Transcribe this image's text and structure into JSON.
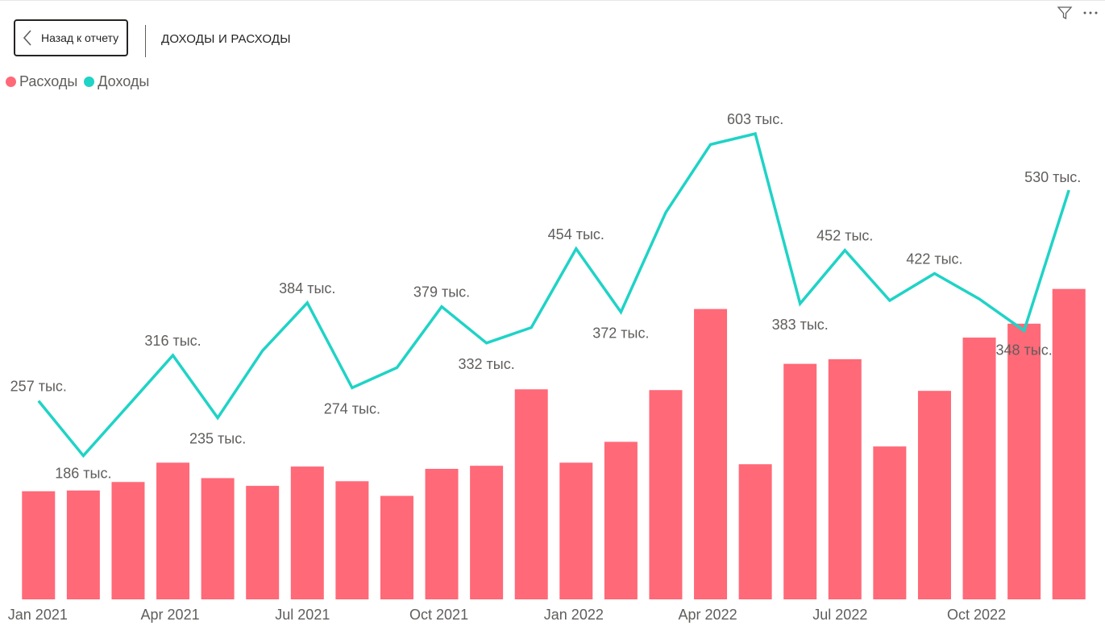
{
  "header": {
    "back_label": "Назад к отчету",
    "title": "ДОХОДЫ И РАСХОДЫ"
  },
  "icons": {
    "back": "chevron-left-icon",
    "filter": "filter-icon",
    "more": "more-options-icon"
  },
  "colors": {
    "expenses": "#FF6978",
    "income": "#1FD3C6",
    "text": "#605e5c"
  },
  "chart_data": {
    "type": "bar",
    "combo": "bar+line",
    "months": [
      "Jan 2021",
      "Feb 2021",
      "Mar 2021",
      "Apr 2021",
      "May 2021",
      "Jun 2021",
      "Jul 2021",
      "Aug 2021",
      "Sep 2021",
      "Oct 2021",
      "Nov 2021",
      "Dec 2021",
      "Jan 2022",
      "Feb 2022",
      "Mar 2022",
      "Apr 2022",
      "May 2022",
      "Jun 2022",
      "Jul 2022",
      "Aug 2022",
      "Sep 2022",
      "Oct 2022",
      "Nov 2022",
      "Dec 2022"
    ],
    "x_tick_labels": [
      {
        "index": 0,
        "label": "Jan 2021"
      },
      {
        "index": 3,
        "label": "Apr 2021"
      },
      {
        "index": 6,
        "label": "Jul 2021"
      },
      {
        "index": 9,
        "label": "Oct 2021"
      },
      {
        "index": 12,
        "label": "Jan 2022"
      },
      {
        "index": 15,
        "label": "Apr 2022"
      },
      {
        "index": 18,
        "label": "Jul 2022"
      },
      {
        "index": 21,
        "label": "Oct 2022"
      }
    ],
    "series": [
      {
        "name": "Расходы",
        "kind": "bar",
        "values": [
          140,
          141,
          152,
          177,
          157,
          147,
          172,
          153,
          134,
          169,
          173,
          272,
          177,
          204,
          271,
          376,
          175,
          305,
          311,
          198,
          270,
          339,
          357,
          402
        ]
      },
      {
        "name": "Доходы",
        "kind": "line",
        "values": [
          257,
          186,
          251,
          316,
          235,
          322,
          384,
          274,
          300,
          379,
          332,
          352,
          454,
          372,
          501,
          589,
          603,
          383,
          452,
          387,
          422,
          389,
          348,
          530
        ]
      }
    ],
    "data_labels": [
      {
        "index": 0,
        "text": "257 тыс."
      },
      {
        "index": 1,
        "text": "186 тыс."
      },
      {
        "index": 3,
        "text": "316 тыс."
      },
      {
        "index": 4,
        "text": "235 тыс."
      },
      {
        "index": 6,
        "text": "384 тыс."
      },
      {
        "index": 7,
        "text": "274 тыс."
      },
      {
        "index": 9,
        "text": "379 тыс."
      },
      {
        "index": 10,
        "text": "332 тыс."
      },
      {
        "index": 12,
        "text": "454 тыс."
      },
      {
        "index": 13,
        "text": "372 тыс."
      },
      {
        "index": 16,
        "text": "603 тыс."
      },
      {
        "index": 17,
        "text": "383 тыс."
      },
      {
        "index": 18,
        "text": "452 тыс."
      },
      {
        "index": 20,
        "text": "422 тыс."
      },
      {
        "index": 22,
        "text": "348 тыс."
      },
      {
        "index": 23,
        "text": "530 тыс."
      }
    ],
    "ylim": [
      0,
      700
    ],
    "grid": false,
    "legend_position": "top-left"
  }
}
